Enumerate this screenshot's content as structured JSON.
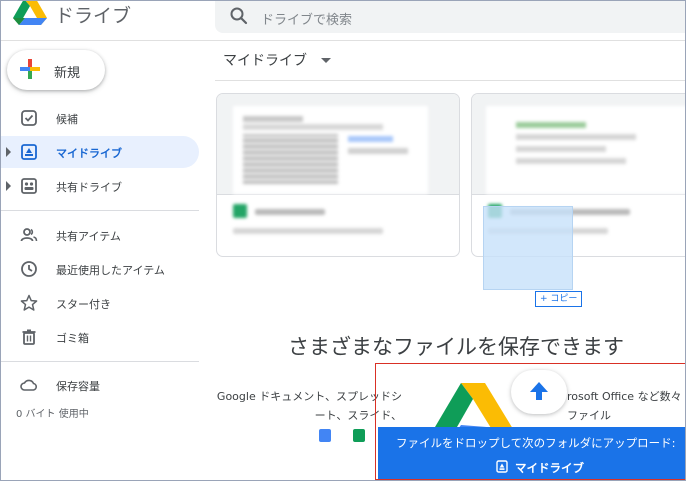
{
  "app": {
    "title": "ドライブ"
  },
  "search": {
    "placeholder": "ドライブで検索"
  },
  "new_button": {
    "label": "新規"
  },
  "sidebar": {
    "items": [
      {
        "label": "候補",
        "icon": "checkbox-icon"
      },
      {
        "label": "マイドライブ",
        "icon": "my-drive-icon",
        "active": true
      },
      {
        "label": "共有ドライブ",
        "icon": "shared-drives-icon"
      },
      {
        "label": "共有アイテム",
        "icon": "people-icon"
      },
      {
        "label": "最近使用したアイテム",
        "icon": "clock-icon"
      },
      {
        "label": "スター付き",
        "icon": "star-icon"
      },
      {
        "label": "ゴミ箱",
        "icon": "trash-icon"
      }
    ],
    "storage": {
      "label": "保存容量",
      "usage": "0 バイト 使用中",
      "icon": "cloud-icon"
    }
  },
  "main": {
    "breadcrumb": "マイドライブ",
    "drag_copy_label": "+ コピー",
    "empty_message": "さまざまなファイルを保存できます",
    "desc_left": "Google ドキュメント、スプレッドシート、スライド、",
    "desc_right_line1": "rosoft Office など数々",
    "desc_right_line2": "ファイル"
  },
  "drop_toast": {
    "message": "ファイルをドロップして次のフォルダにアップロード:",
    "folder": "マイドライブ"
  },
  "colors": {
    "accent": "#1a73e8",
    "active_bg": "#e8f0fe",
    "active_text": "#1967d2",
    "highlight_border": "#d93025"
  }
}
